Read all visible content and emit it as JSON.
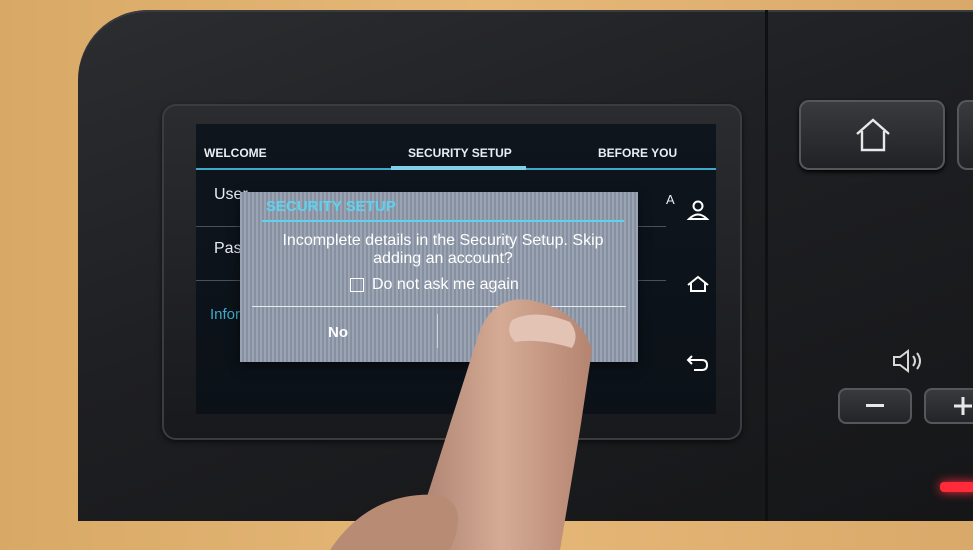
{
  "tabs": [
    {
      "label": "WELCOME"
    },
    {
      "label": "SECURITY SETUP"
    },
    {
      "label": "BEFORE YOU"
    }
  ],
  "form": {
    "username_label": "User",
    "password_label": "Pass",
    "info_link": "Infor",
    "side_letter": "A"
  },
  "side_icons": [
    "user-icon",
    "home-icon",
    "back-icon"
  ],
  "dialog": {
    "title": "SECURITY SETUP",
    "message": "Incomplete details in the Security Setup. Skip adding an account?",
    "checkbox_label": "Do not ask me again",
    "checkbox_checked": false,
    "no_label": "No"
  },
  "hardware": {
    "buttons": [
      "home-icon",
      "minus-icon",
      "plus-icon"
    ],
    "speaker_icon": "speaker-icon",
    "status_led_color": "#ff2b3a"
  },
  "colors": {
    "accent": "#3fa9c9",
    "dialog_title": "#5bd4f2"
  }
}
